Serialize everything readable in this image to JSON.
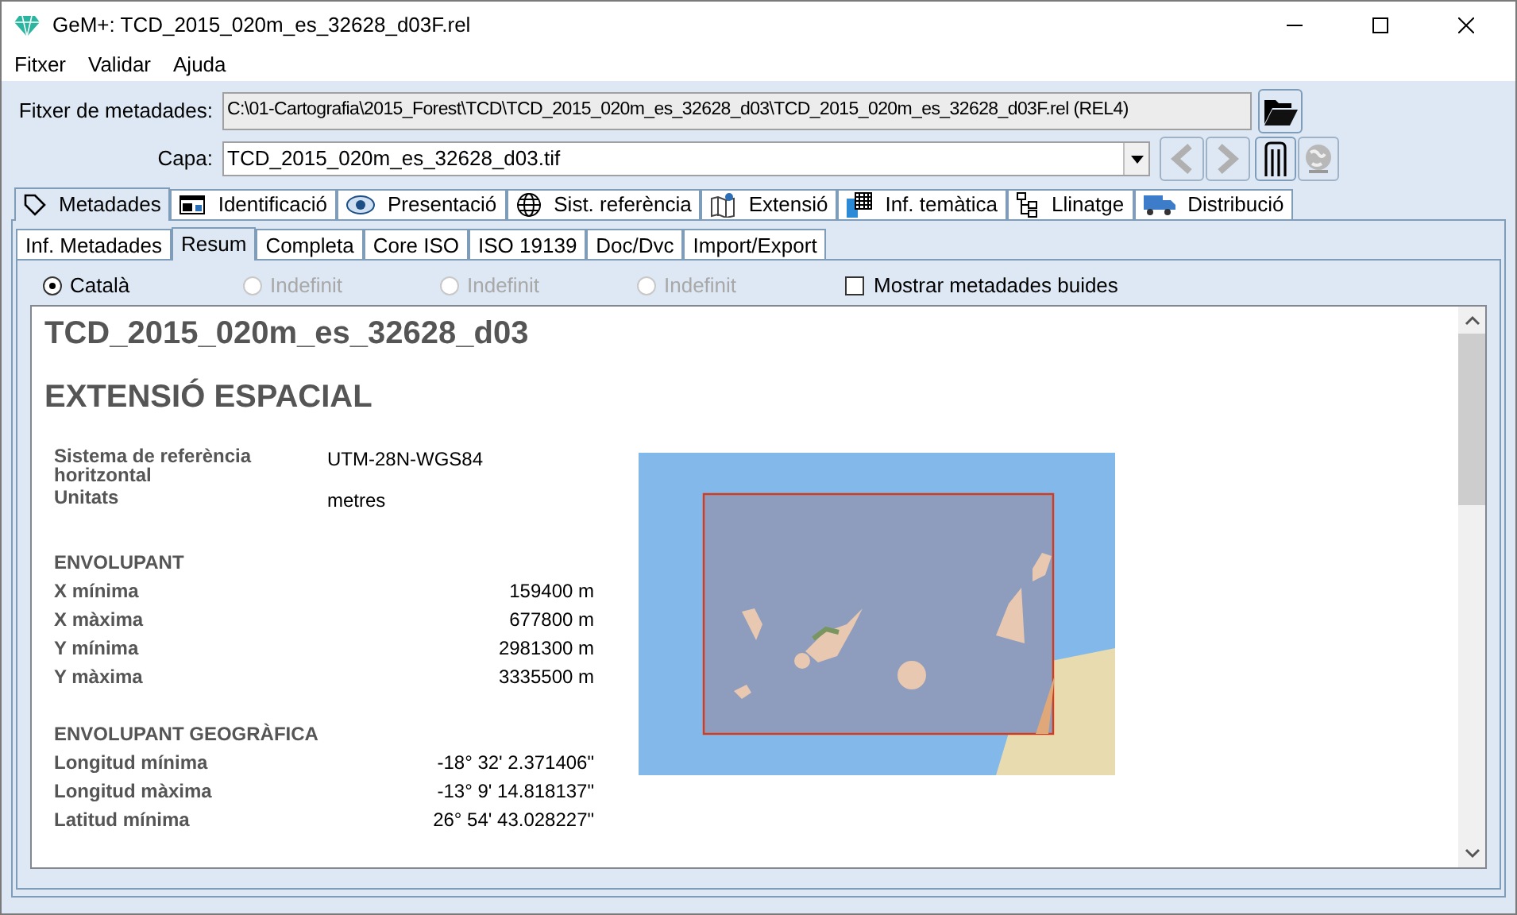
{
  "window": {
    "title": "GeM+: TCD_2015_020m_es_32628_d03F.rel"
  },
  "menu": [
    "Fitxer",
    "Validar",
    "Ajuda"
  ],
  "file_field": {
    "label": "Fitxer de metadades:",
    "value": "C:\\01-Cartografia\\2015_Forest\\TCD\\TCD_2015_020m_es_32628_d03\\TCD_2015_020m_es_32628_d03F.rel (REL4)"
  },
  "layer_field": {
    "label": "Capa:",
    "value": "TCD_2015_020m_es_32628_d03.tif"
  },
  "tabs": [
    {
      "label": "Metadades",
      "kind": "tag",
      "selected": true
    },
    {
      "label": "Identificació",
      "kind": "card",
      "selected": false
    },
    {
      "label": "Presentació",
      "kind": "eye",
      "selected": false
    },
    {
      "label": "Sist. referència",
      "kind": "globe",
      "selected": false
    },
    {
      "label": "Extensió",
      "kind": "map",
      "selected": false
    },
    {
      "label": "Inf. temàtica",
      "kind": "table",
      "selected": false
    },
    {
      "label": "Llinatge",
      "kind": "tree",
      "selected": false
    },
    {
      "label": "Distribució",
      "kind": "truck",
      "selected": false
    }
  ],
  "subtabs": [
    {
      "label": "Inf. Metadades",
      "selected": false
    },
    {
      "label": "Resum",
      "selected": true
    },
    {
      "label": "Completa",
      "selected": false
    },
    {
      "label": "Core ISO",
      "selected": false
    },
    {
      "label": "ISO 19139",
      "selected": false
    },
    {
      "label": "Doc/Dvc",
      "selected": false
    },
    {
      "label": "Import/Export",
      "selected": false
    }
  ],
  "languages": [
    {
      "label": "Català",
      "selected": true,
      "disabled": false
    },
    {
      "label": "Indefinit",
      "selected": false,
      "disabled": true
    },
    {
      "label": "Indefinit",
      "selected": false,
      "disabled": true
    },
    {
      "label": "Indefinit",
      "selected": false,
      "disabled": true
    }
  ],
  "show_empty": {
    "label": "Mostrar metadades buides",
    "checked": false
  },
  "document": {
    "title": "TCD_2015_020m_es_32628_d03",
    "section": "EXTENSIÓ ESPACIAL",
    "info": [
      {
        "label": "Sistema de referència horitzontal",
        "value": "UTM-28N-WGS84"
      },
      {
        "label": "Unitats",
        "value": "metres"
      }
    ],
    "groups": [
      {
        "heading": "ENVOLUPANT",
        "rows": [
          {
            "label": "X mínima",
            "value": "159400 m"
          },
          {
            "label": "X màxima",
            "value": "677800 m"
          },
          {
            "label": "Y mínima",
            "value": "2981300 m"
          },
          {
            "label": "Y màxima",
            "value": "3335500 m"
          }
        ]
      },
      {
        "heading": "ENVOLUPANT GEOGRÀFICA",
        "rows": [
          {
            "label": "Longitud mínima",
            "value": "-18° 32' 2.371406\""
          },
          {
            "label": "Longitud màxima",
            "value": "-13° 9' 14.818137\""
          },
          {
            "label": "Latitud mínima",
            "value": "26° 54' 43.028227\""
          }
        ]
      }
    ]
  }
}
